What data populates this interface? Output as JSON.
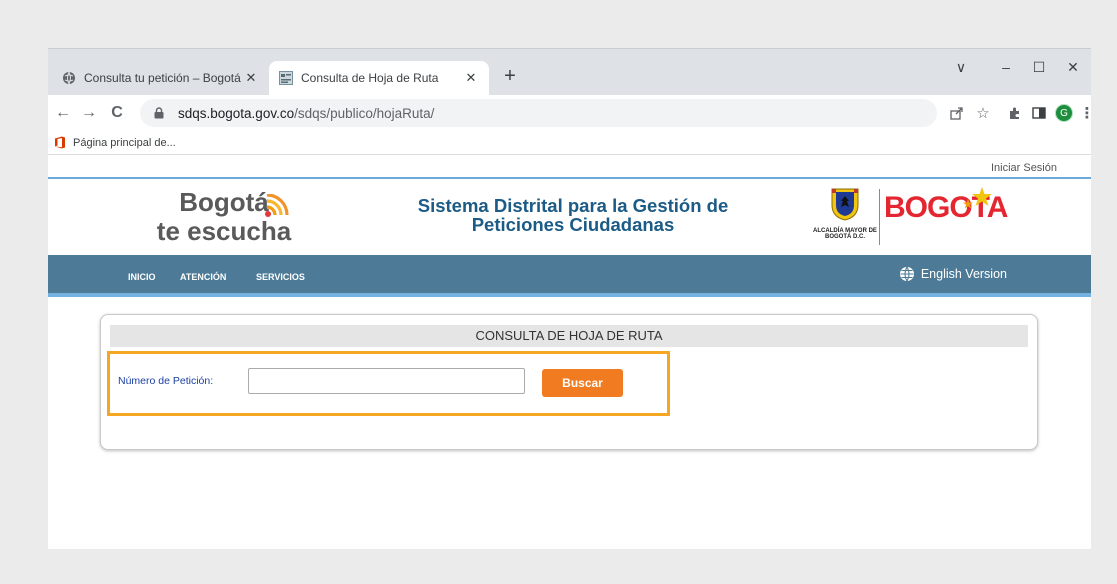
{
  "browser": {
    "tabs": [
      {
        "title": "Consulta tu petición – Bogotá te escucha",
        "icon": "globe-icon",
        "active": false
      },
      {
        "title": "Consulta de Hoja de Ruta",
        "icon": "site-favicon",
        "active": true
      }
    ],
    "new_tab": "+",
    "window_controls": {
      "tab_search": "∨",
      "minimize": "–",
      "maximize": "☐",
      "close": "✕"
    },
    "nav": {
      "back": "←",
      "forward": "→",
      "reload": "C"
    },
    "address": {
      "host": "sdqs.bogota.gov.co",
      "path": "/sdqs/publico/hojaRuta/"
    },
    "toolbar_icons": [
      "share-icon",
      "star-icon",
      "extensions-icon",
      "sidepanel-icon",
      "profile-avatar",
      "menu-icon"
    ],
    "profile_initial": "G",
    "bookmarks": [
      {
        "label": "Página principal de...",
        "icon": "office-icon"
      }
    ]
  },
  "page": {
    "login_link": "Iniciar Sesión",
    "logo": {
      "line1": "Bogotá",
      "line2": "te escucha"
    },
    "system_title": "Sistema Distrital para la Gestión de Peticiones Ciudadanas",
    "seal_caption": "ALCALDÍA MAYOR DE BOGOTÁ D.C.",
    "city_logo": "BOGOTA",
    "nav_items": [
      "INICIO",
      "ATENCIÓN",
      "SERVICIOS"
    ],
    "english_link": "English Version",
    "panel_title": "CONSULTA DE HOJA DE RUTA",
    "petition_label": "Número de Petición:",
    "petition_value": "",
    "search_button": "Buscar"
  },
  "colors": {
    "nav_bar": "#4d7b97",
    "button": "#f07b20",
    "highlight_frame": "#f5a623",
    "title_blue": "#1b5b86",
    "bogota_red": "#e32630"
  }
}
